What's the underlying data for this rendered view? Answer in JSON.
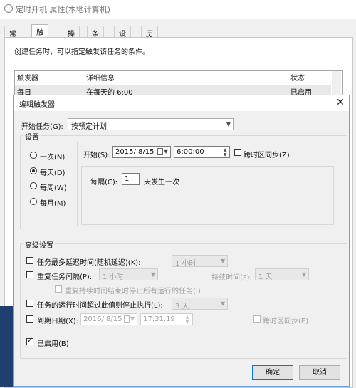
{
  "background_window": {
    "title": "定时开机 属性(本地计算机)",
    "tabs": [
      "常规",
      "触发器",
      "操作",
      "条件",
      "设置",
      "历史记录"
    ],
    "selected_tab": "触发器",
    "description": "创建任务时，可以指定触发该任务的条件。",
    "table": {
      "columns": [
        "触发器",
        "详细信息",
        "状态"
      ],
      "rows": [
        [
          "每日",
          "在每天的 6:00",
          "已启用"
        ]
      ]
    }
  },
  "dialog": {
    "title": "编辑触发器",
    "begin_task_label": "开始任务(G):",
    "begin_task_value": "按预定计划",
    "settings": {
      "legend": "设置",
      "radios": [
        {
          "label": "一次(N)",
          "checked": false
        },
        {
          "label": "每天(D)",
          "checked": true
        },
        {
          "label": "每周(W)",
          "checked": false
        },
        {
          "label": "每月(M)",
          "checked": false
        }
      ],
      "start_label": "开始(S):",
      "start_date": "2015/ 8/15",
      "start_time": "6:00:00",
      "sync_timezone_label": "跨时区同步(Z)",
      "sync_timezone_checked": false,
      "recur_label": "每隔(C):",
      "recur_value": "1",
      "recur_suffix": "天发生一次"
    },
    "advanced": {
      "legend": "高级设置",
      "delay_label": "任务最多延迟时间(随机延迟)(K):",
      "delay_checked": false,
      "delay_value": "1 小时",
      "repeat_label": "重复任务间隔(P):",
      "repeat_checked": false,
      "repeat_value": "1 小时",
      "duration_label": "持续时间(F):",
      "duration_value": "1 天",
      "stop_all_label": "重复持续时间结束时停止所有运行的任务(I)",
      "stop_all_checked": false,
      "stop_longer_label": "任务的运行时间超过此值则停止执行(L):",
      "stop_longer_checked": false,
      "stop_longer_value": "3 天",
      "expire_label": "到期日期(X):",
      "expire_checked": false,
      "expire_date": "2016/ 8/15",
      "expire_time": "17:31:19",
      "expire_sync_label": "跨时区同步(E)",
      "expire_sync_checked": false,
      "enabled_label": "已启用(B)",
      "enabled_checked": true
    },
    "ok_label": "确定",
    "cancel_label": "取消"
  }
}
